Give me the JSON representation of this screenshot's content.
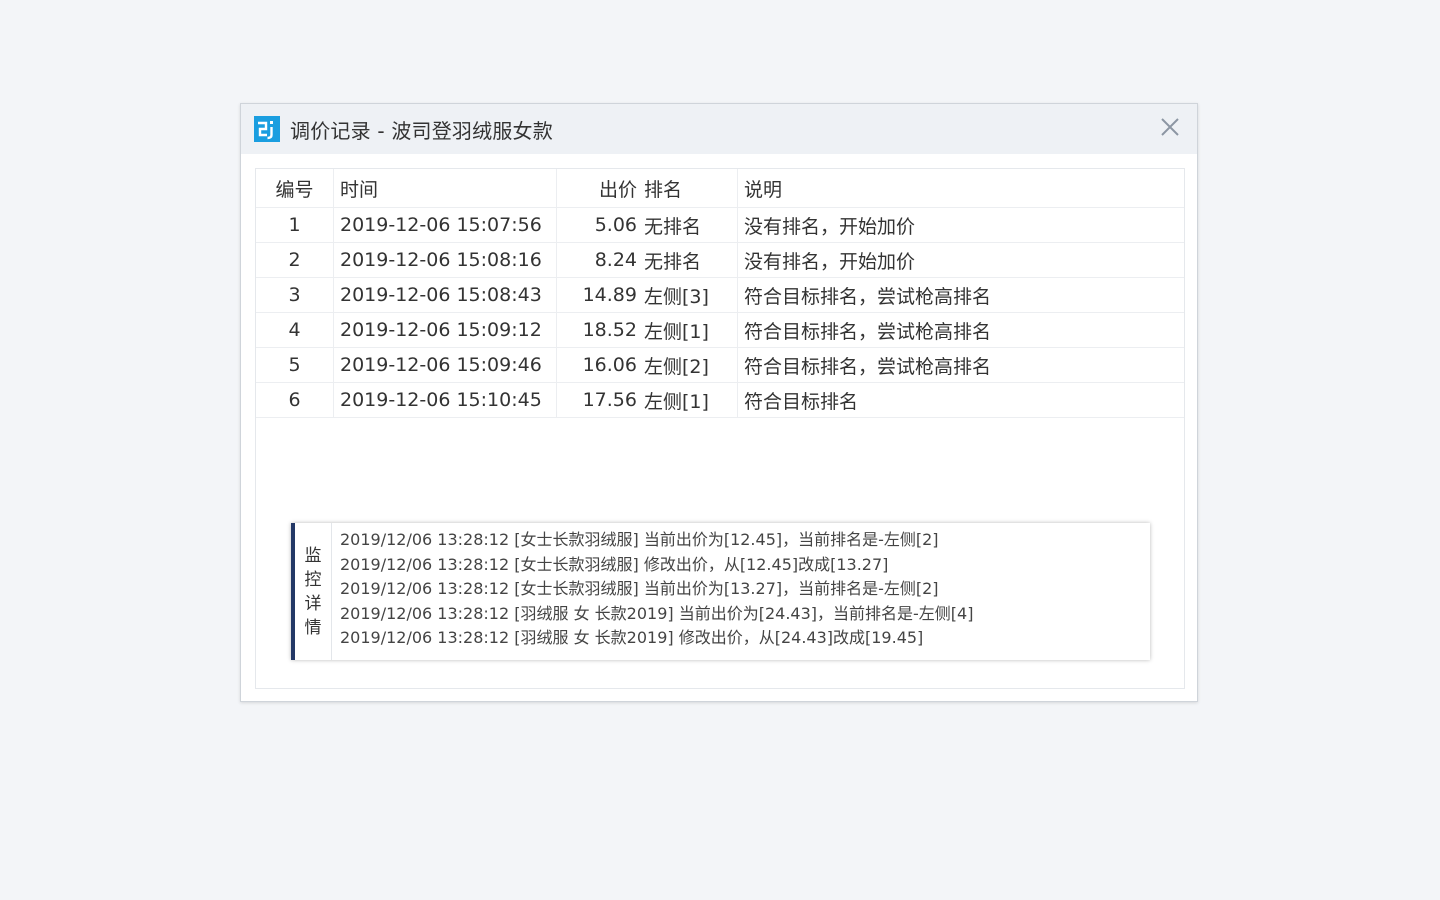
{
  "dialog": {
    "title": "调价记录 - 波司登羽绒服女款",
    "logo_icon": "app-logo-icon",
    "close_icon": "close-icon",
    "accent": "#1a9ee0"
  },
  "table": {
    "headers": {
      "id": "编号",
      "time": "时间",
      "price": "出价",
      "rank": "排名",
      "desc": "说明"
    },
    "rows": [
      {
        "id": "1",
        "time": "2019-12-06 15:07:56",
        "price": "5.06",
        "rank": "无排名",
        "desc": "没有排名，开始加价"
      },
      {
        "id": "2",
        "time": "2019-12-06 15:08:16",
        "price": "8.24",
        "rank": "无排名",
        "desc": "没有排名，开始加价"
      },
      {
        "id": "3",
        "time": "2019-12-06 15:08:43",
        "price": "14.89",
        "rank": "左侧[3]",
        "desc": "符合目标排名，尝试枪高排名"
      },
      {
        "id": "4",
        "time": "2019-12-06 15:09:12",
        "price": "18.52",
        "rank": "左侧[1]",
        "desc": "符合目标排名，尝试枪高排名"
      },
      {
        "id": "5",
        "time": "2019-12-06 15:09:46",
        "price": "16.06",
        "rank": "左侧[2]",
        "desc": "符合目标排名，尝试枪高排名"
      },
      {
        "id": "6",
        "time": "2019-12-06 15:10:45",
        "price": "17.56",
        "rank": "左侧[1]",
        "desc": "符合目标排名"
      }
    ]
  },
  "monitor": {
    "label_chars": [
      "监",
      "控",
      "详",
      "情"
    ],
    "bar_color": "#233866",
    "lines": [
      "2019/12/06 13:28:12 [女士长款羽绒服] 当前出价为[12.45]，当前排名是-左侧[2]",
      "2019/12/06 13:28:12 [女士长款羽绒服] 修改出价，从[12.45]改成[13.27]",
      "2019/12/06 13:28:12 [女士长款羽绒服] 当前出价为[13.27]，当前排名是-左侧[2]",
      "2019/12/06 13:28:12 [羽绒服 女 长款2019] 当前出价为[24.43]，当前排名是-左侧[4]",
      "2019/12/06 13:28:12 [羽绒服 女 长款2019] 修改出价，从[24.43]改成[19.45]"
    ]
  }
}
